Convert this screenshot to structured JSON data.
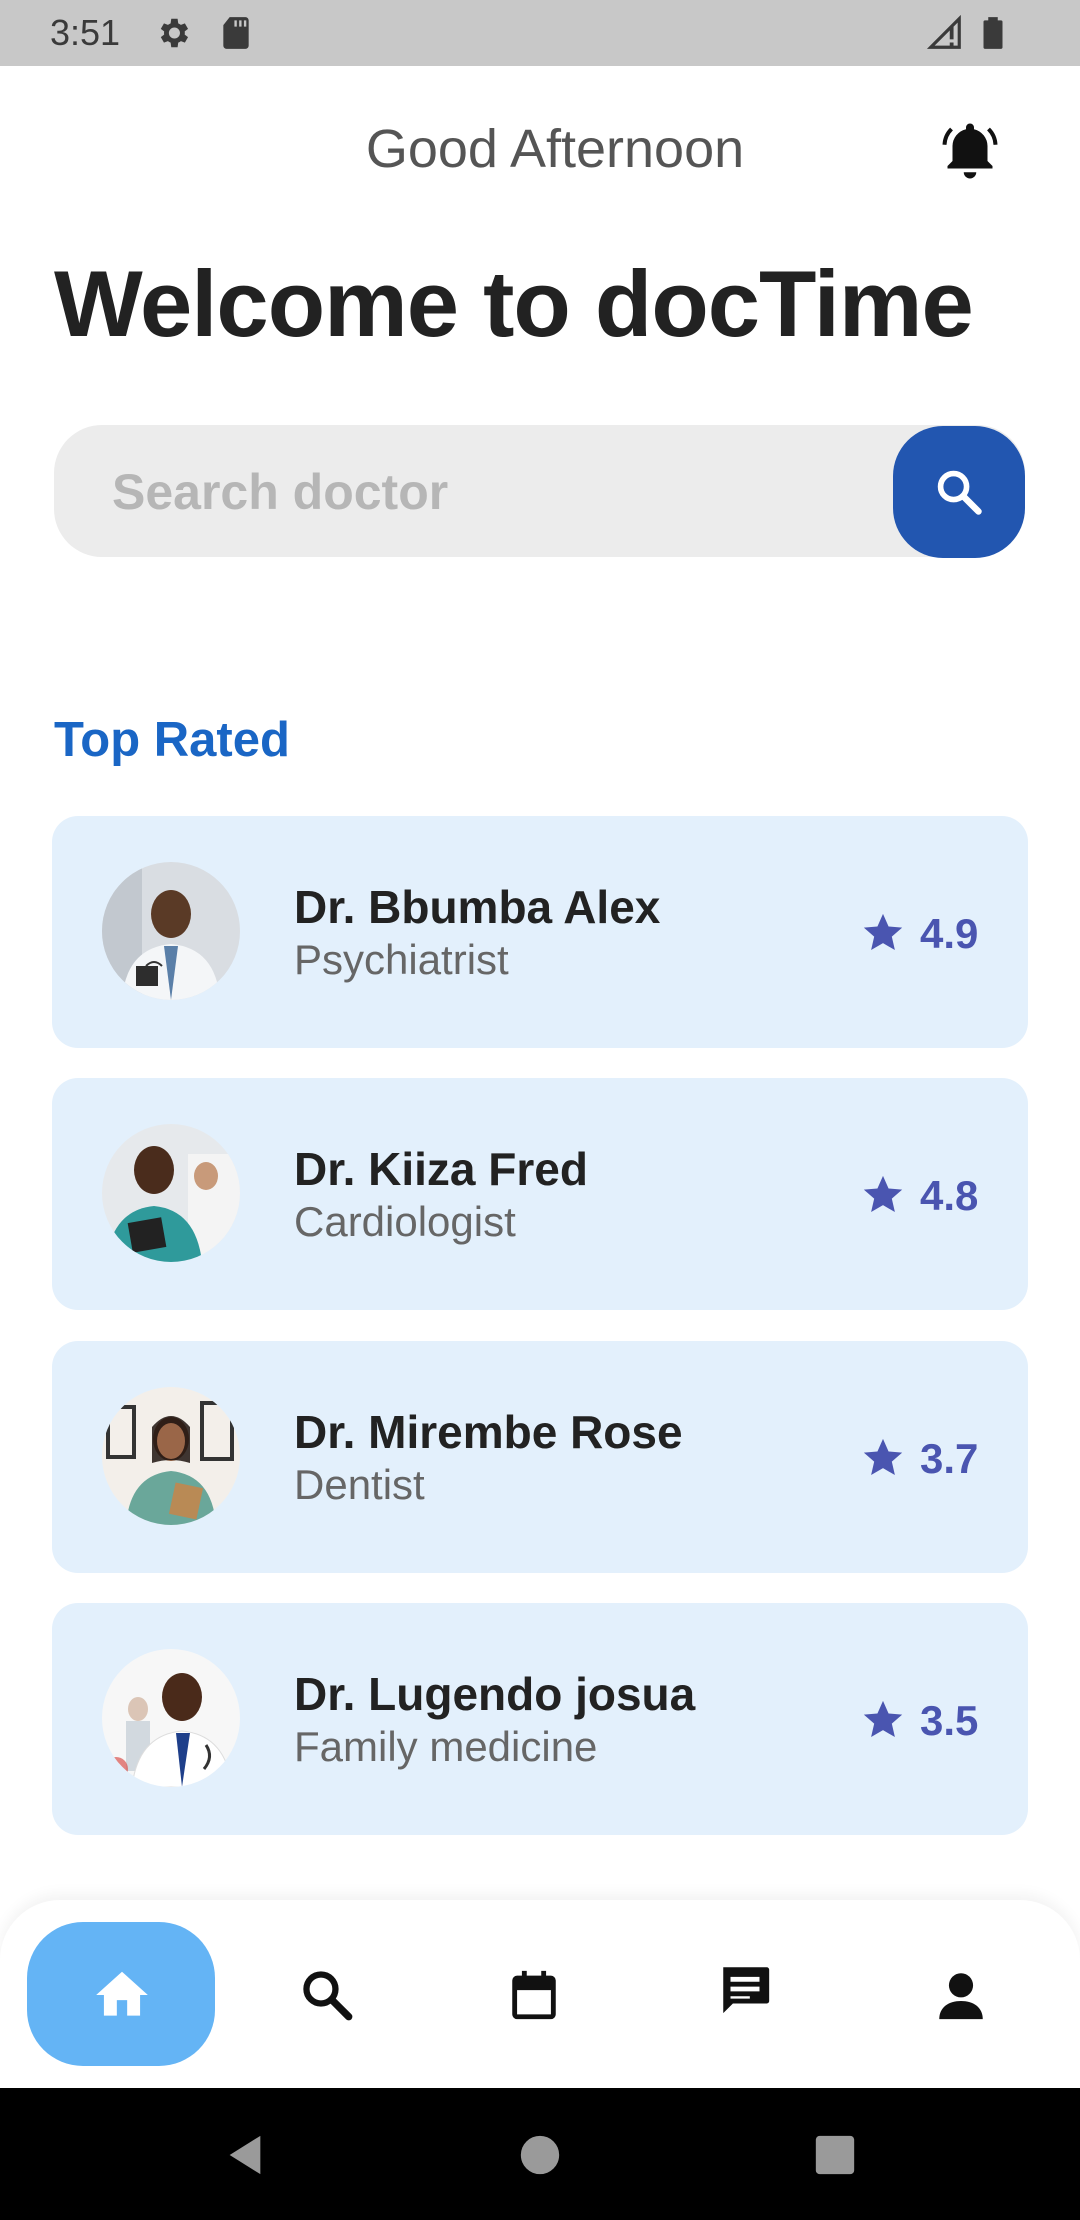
{
  "status_bar": {
    "time": "3:51",
    "icons": [
      "settings-icon",
      "sd-card-icon",
      "signal-icon",
      "battery-icon"
    ]
  },
  "header": {
    "greeting": "Good Afternoon",
    "title": "Welcome to docTime",
    "notification_icon": "bell-icon"
  },
  "search": {
    "placeholder": "Search doctor",
    "value": "",
    "button_icon": "search-icon"
  },
  "top_rated": {
    "title": "Top Rated",
    "doctors": [
      {
        "name": "Dr. Bbumba Alex",
        "specialty": "Psychiatrist",
        "rating": "4.9"
      },
      {
        "name": "Dr. Kiiza Fred",
        "specialty": "Cardiologist",
        "rating": "4.8"
      },
      {
        "name": "Dr. Mirembe Rose",
        "specialty": "Dentist",
        "rating": "3.7"
      },
      {
        "name": "Dr. Lugendo josua",
        "specialty": "Family medicine",
        "rating": "3.5"
      }
    ]
  },
  "bottom_nav": {
    "items": [
      "home-icon",
      "search-icon",
      "calendar-icon",
      "chat-icon",
      "profile-icon"
    ],
    "active": "home-icon"
  },
  "colors": {
    "primary": "#2256b0",
    "accent_text": "#1a66c5",
    "card_bg": "#e3f0fc",
    "rating": "#4a55b0",
    "nav_active": "#64b4f5"
  }
}
